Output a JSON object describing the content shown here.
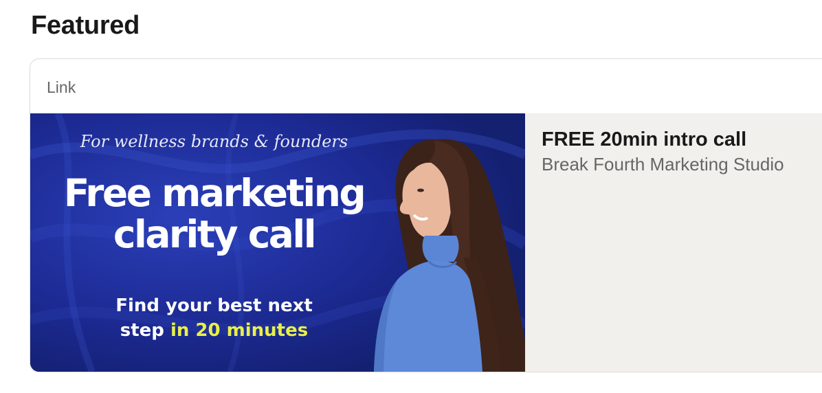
{
  "section": {
    "title": "Featured"
  },
  "featured_card": {
    "type_label": "Link",
    "thumbnail": {
      "kicker": "For wellness brands & founders",
      "headline_line1": "Free marketing",
      "headline_line2": "clarity call",
      "subline1": "Find your best next",
      "subline2_plain": "step ",
      "subline2_highlight": "in 20 minutes"
    },
    "title": "FREE 20min intro call",
    "subtitle": "Break Fourth Marketing Studio"
  }
}
